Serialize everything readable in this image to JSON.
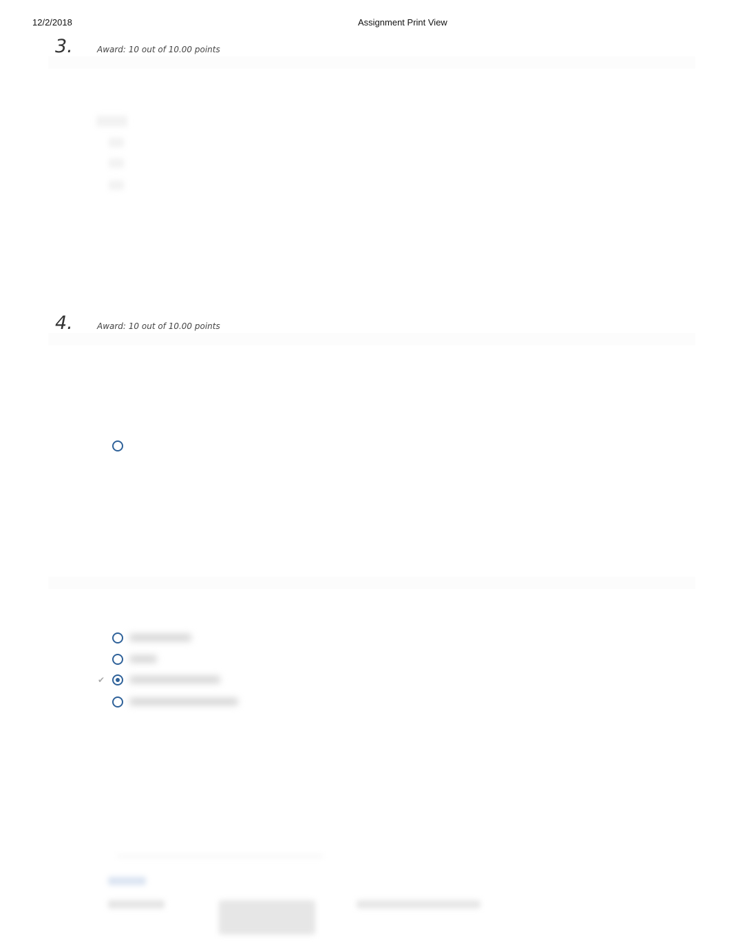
{
  "header": {
    "date": "12/2/2018",
    "title": "Assignment Print View"
  },
  "questions": [
    {
      "number": "3.",
      "award": "Award: 10 out of 10.00 points"
    },
    {
      "number": "4.",
      "award": "Award: 10 out of 10.00 points",
      "options": [
        {
          "label": "",
          "selected": false,
          "correct": false
        },
        {
          "label": "",
          "selected": false,
          "correct": false
        },
        {
          "label": "",
          "selected": true,
          "correct": true
        },
        {
          "label": "",
          "selected": false,
          "correct": false
        }
      ]
    }
  ],
  "icons": {
    "check": "✔"
  }
}
